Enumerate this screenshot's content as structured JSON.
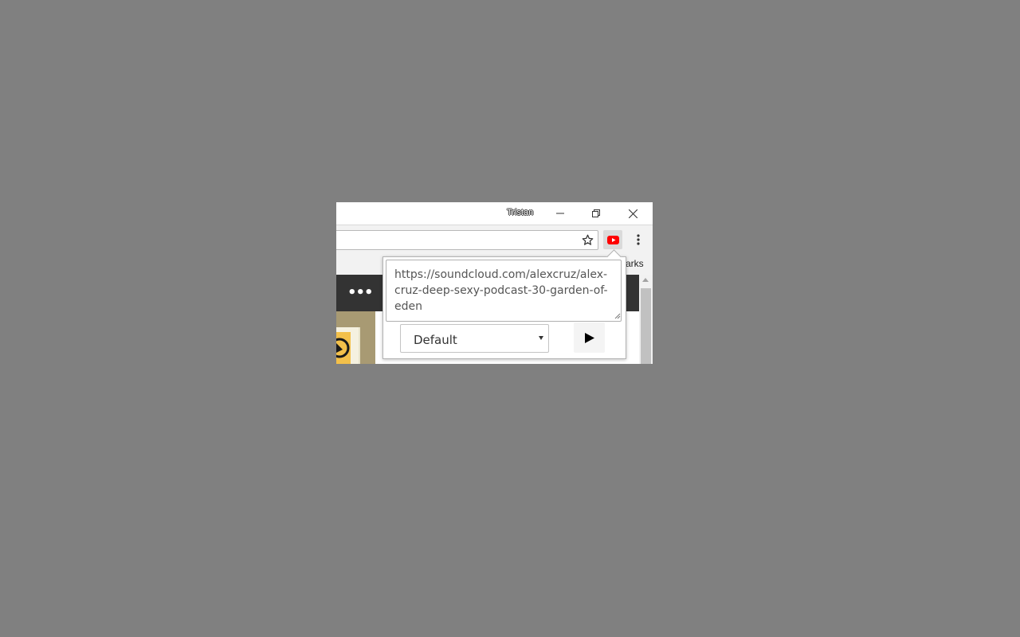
{
  "window": {
    "profile_name": "Tristan"
  },
  "toolbar": {
    "extension_icon": "youtube-icon",
    "star_icon": "star-icon",
    "menu_icon": "more-vert-icon"
  },
  "bookmarks_bar": {
    "label": "arks"
  },
  "page": {
    "header_dots": "•••"
  },
  "popup": {
    "url_value": "https://soundcloud.com/alexcruz/alex-cruz-deep-sexy-podcast-30-garden-of-eden",
    "quality_selected": "Default",
    "play_icon": "play-icon"
  },
  "colors": {
    "desktop": "#808080",
    "extension_red": "#ff0000",
    "page_header": "#333333"
  }
}
